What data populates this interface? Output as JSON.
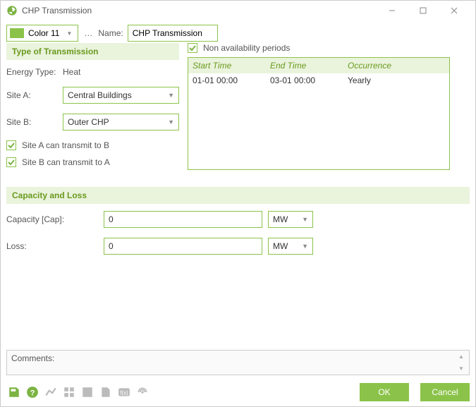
{
  "window": {
    "title": "CHP Transmission"
  },
  "toolbar": {
    "color_label": "Color 11",
    "name_label": "Name:",
    "name_value": "CHP Transmission"
  },
  "transmission": {
    "header": "Type of Transmission",
    "energy_label": "Energy Type:",
    "energy_value": "Heat",
    "site_a_label": "Site A:",
    "site_a_value": "Central Buildings",
    "site_b_label": "Site B:",
    "site_b_value": "Outer CHP",
    "a_to_b": "Site A can transmit to B",
    "b_to_a": "Site B can transmit to A"
  },
  "nonavail": {
    "label": "Non availability periods",
    "cols": {
      "start": "Start Time",
      "end": "End Time",
      "occ": "Occurrence"
    },
    "rows": [
      {
        "start": "01-01 00:00",
        "end": "03-01 00:00",
        "occ": "Yearly"
      }
    ]
  },
  "capacity": {
    "header": "Capacity and Loss",
    "cap_label": "Capacity [Cap]:",
    "cap_value": "0",
    "cap_unit": "MW",
    "loss_label": "Loss:",
    "loss_value": "0",
    "loss_unit": "MW"
  },
  "comments_label": "Comments:",
  "buttons": {
    "ok": "OK",
    "cancel": "Cancel"
  }
}
